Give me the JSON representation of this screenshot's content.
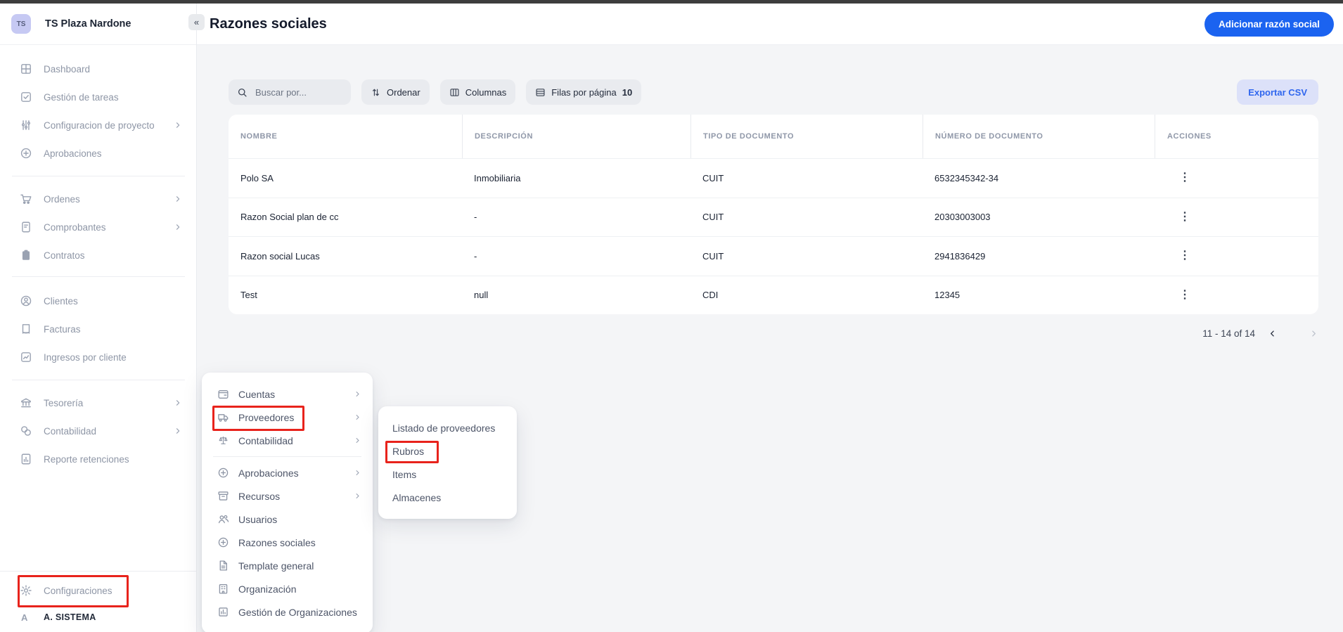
{
  "workspace": {
    "initials": "TS",
    "name": "TS Plaza Nardone"
  },
  "header": {
    "collapse_glyph": "«",
    "title": "Razones sociales",
    "add_button_label": "Adicionar razón social"
  },
  "toolbar": {
    "search_placeholder": "Buscar por...",
    "sort_label": "Ordenar",
    "columns_label": "Columnas",
    "rows_per_page_label": "Filas por página",
    "rows_per_page_value": "10",
    "export_label": "Exportar CSV"
  },
  "table": {
    "columns": [
      "NOMBRE",
      "DESCRIPCIÓN",
      "TIPO DE DOCUMENTO",
      "NÚMERO DE DOCUMENTO",
      "ACCIONES"
    ],
    "kebab_glyph": "⋮",
    "rows": [
      [
        "Polo SA",
        "Inmobiliaria",
        "CUIT",
        "6532345342-34"
      ],
      [
        "Razon Social plan de cc",
        "-",
        "CUIT",
        "20303003003"
      ],
      [
        "Razon social Lucas",
        "-",
        "CUIT",
        "2941836429"
      ],
      [
        "Test",
        "null",
        "CDI",
        "12345"
      ]
    ]
  },
  "pagination": {
    "range": "11 - 14 of 14"
  },
  "sidebar": {
    "groups": [
      {
        "items": [
          {
            "label": "Dashboard"
          },
          {
            "label": "Gestión de tareas"
          },
          {
            "label": "Configuracion de proyecto"
          },
          {
            "label": "Aprobaciones"
          }
        ]
      },
      {
        "items": [
          {
            "label": "Ordenes"
          },
          {
            "label": "Comprobantes"
          },
          {
            "label": "Contratos"
          }
        ]
      },
      {
        "items": [
          {
            "label": "Clientes"
          },
          {
            "label": "Facturas"
          },
          {
            "label": "Ingresos por cliente"
          }
        ]
      },
      {
        "items": [
          {
            "label": "Tesorería"
          },
          {
            "label": "Contabilidad"
          },
          {
            "label": "Reporte retenciones"
          }
        ]
      }
    ],
    "footer": {
      "settings_label": "Configuraciones",
      "user_initial": "A",
      "user_name": "A. SISTEMA"
    }
  },
  "settings_menu": {
    "items": [
      {
        "label": "Cuentas"
      },
      {
        "label": "Proveedores"
      },
      {
        "label": "Contabilidad"
      },
      {
        "label": "Aprobaciones"
      },
      {
        "label": "Recursos"
      },
      {
        "label": "Usuarios"
      },
      {
        "label": "Razones sociales"
      },
      {
        "label": "Template general"
      },
      {
        "label": "Organización"
      },
      {
        "label": "Gestión de Organizaciones"
      }
    ]
  },
  "proveedores_submenu": {
    "items": [
      {
        "label": "Listado de proveedores"
      },
      {
        "label": "Rubros"
      },
      {
        "label": "Items"
      },
      {
        "label": "Almacenes"
      }
    ]
  },
  "annotations": {
    "highlight_color": "#e8231c",
    "highlighted": [
      "Proveedores",
      "Rubros",
      "Configuraciones"
    ]
  },
  "colors": {
    "accent_blue": "#1b63f0",
    "export_bg": "#dce1f9",
    "page_bg": "#f4f5f7",
    "top_strip": "#3d3d3d"
  }
}
